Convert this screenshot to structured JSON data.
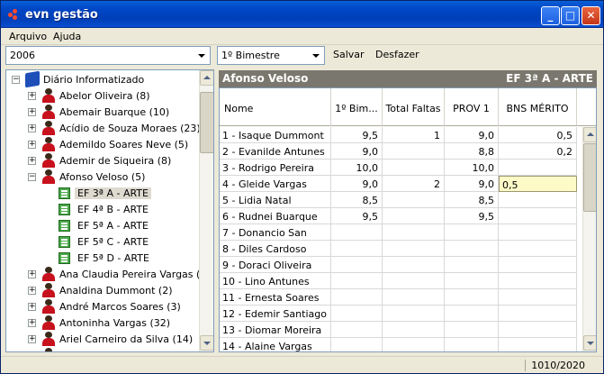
{
  "window": {
    "title": "evn gestão"
  },
  "menu": [
    "Arquivo",
    "Ajuda"
  ],
  "toolbar": {
    "year": "2006",
    "period": "1º Bimestre",
    "save": "Salvar",
    "undo": "Desfazer"
  },
  "tree": {
    "root": "Diário Informatizado",
    "teachers_before": [
      "Abelor Oliveira (8)",
      "Abemair Buarque (10)",
      "Acídio de Souza Moraes (23)",
      "Ademildo Soares Neve (5)",
      "Ademir de Siqueira (8)"
    ],
    "expanded_teacher": "Afonso Veloso (5)",
    "classes": [
      "EF 3ª A - ARTE",
      "EF 4ª B - ARTE",
      "EF 5ª A - ARTE",
      "EF 5ª C - ARTE",
      "EF 5ª D - ARTE"
    ],
    "teachers_after": [
      "Ana Claudia Pereira Vargas (1)",
      "Analdina Dummont (2)",
      "André Marcos Soares (3)",
      "Antoninha Vargas (32)",
      "Ariel Carneiro da Silva (14)",
      "Artur Fr..."
    ]
  },
  "grid": {
    "teacher": "Afonso Veloso",
    "class": "EF 3ª A - ARTE",
    "columns": [
      "Nome",
      "1º Bim...",
      "Total Faltas",
      "PROV 1",
      "BNS MÉRITO"
    ],
    "rows": [
      [
        "1 - Isaque Dummont",
        "9,5",
        "1",
        "9,0",
        "0,5"
      ],
      [
        "2 - Evanilde Antunes",
        "9,0",
        "",
        "8,8",
        "0,2"
      ],
      [
        "3 - Rodrigo Pereira",
        "10,0",
        "",
        "10,0",
        ""
      ],
      [
        "4 - Gleide Vargas",
        "9,0",
        "2",
        "9,0",
        "0,5"
      ],
      [
        "5 - Lidia Natal",
        "8,5",
        "",
        "8,5",
        ""
      ],
      [
        "6 - Rudnei Buarque",
        "9,5",
        "",
        "9,5",
        ""
      ],
      [
        "7 - Donancio San",
        "",
        "",
        "",
        ""
      ],
      [
        "8 - Diles Cardoso",
        "",
        "",
        "",
        ""
      ],
      [
        "9 - Doraci Oliveira",
        "",
        "",
        "",
        ""
      ],
      [
        "10 - Lino Antunes",
        "",
        "",
        "",
        ""
      ],
      [
        "11 - Ernesta Soares",
        "",
        "",
        "",
        ""
      ],
      [
        "12 - Edemir Santiago",
        "",
        "",
        "",
        ""
      ],
      [
        "13 - Diomar Moreira",
        "",
        "",
        "",
        ""
      ],
      [
        "14 - Alaine Vargas",
        "",
        "",
        "",
        ""
      ]
    ],
    "editing_row": 3,
    "editing_col": 4
  },
  "status": {
    "page": "1010/2020"
  }
}
